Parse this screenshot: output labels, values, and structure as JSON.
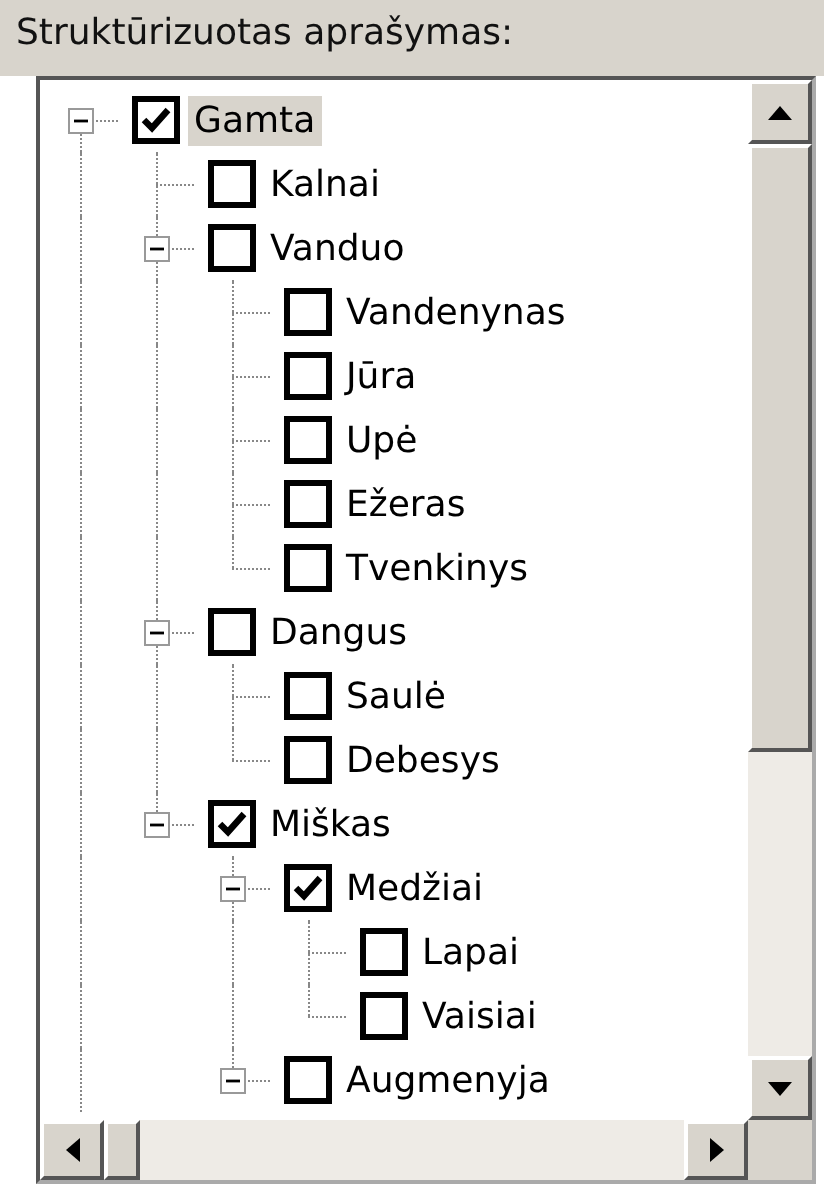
{
  "heading": "Struktūrizuotas aprašymas:",
  "tree": [
    {
      "label": "Gamta",
      "checked": true,
      "selected": true,
      "expanded": true,
      "children": [
        {
          "label": "Kalnai",
          "checked": false,
          "selected": false
        },
        {
          "label": "Vanduo",
          "checked": false,
          "selected": false,
          "expanded": true,
          "children": [
            {
              "label": "Vandenynas",
              "checked": false,
              "selected": false
            },
            {
              "label": "Jūra",
              "checked": false,
              "selected": false
            },
            {
              "label": "Upė",
              "checked": false,
              "selected": false
            },
            {
              "label": "Ežeras",
              "checked": false,
              "selected": false
            },
            {
              "label": "Tvenkinys",
              "checked": false,
              "selected": false
            }
          ]
        },
        {
          "label": "Dangus",
          "checked": false,
          "selected": false,
          "expanded": true,
          "children": [
            {
              "label": "Saulė",
              "checked": false,
              "selected": false
            },
            {
              "label": "Debesys",
              "checked": false,
              "selected": false
            }
          ]
        },
        {
          "label": "Miškas",
          "checked": true,
          "selected": false,
          "expanded": true,
          "children": [
            {
              "label": "Medžiai",
              "checked": true,
              "selected": false,
              "expanded": true,
              "children": [
                {
                  "label": "Lapai",
                  "checked": false,
                  "selected": false
                },
                {
                  "label": "Vaisiai",
                  "checked": false,
                  "selected": false
                }
              ]
            },
            {
              "label": "Augmenyja",
              "checked": false,
              "selected": false,
              "expanded": true
            }
          ]
        }
      ]
    }
  ]
}
